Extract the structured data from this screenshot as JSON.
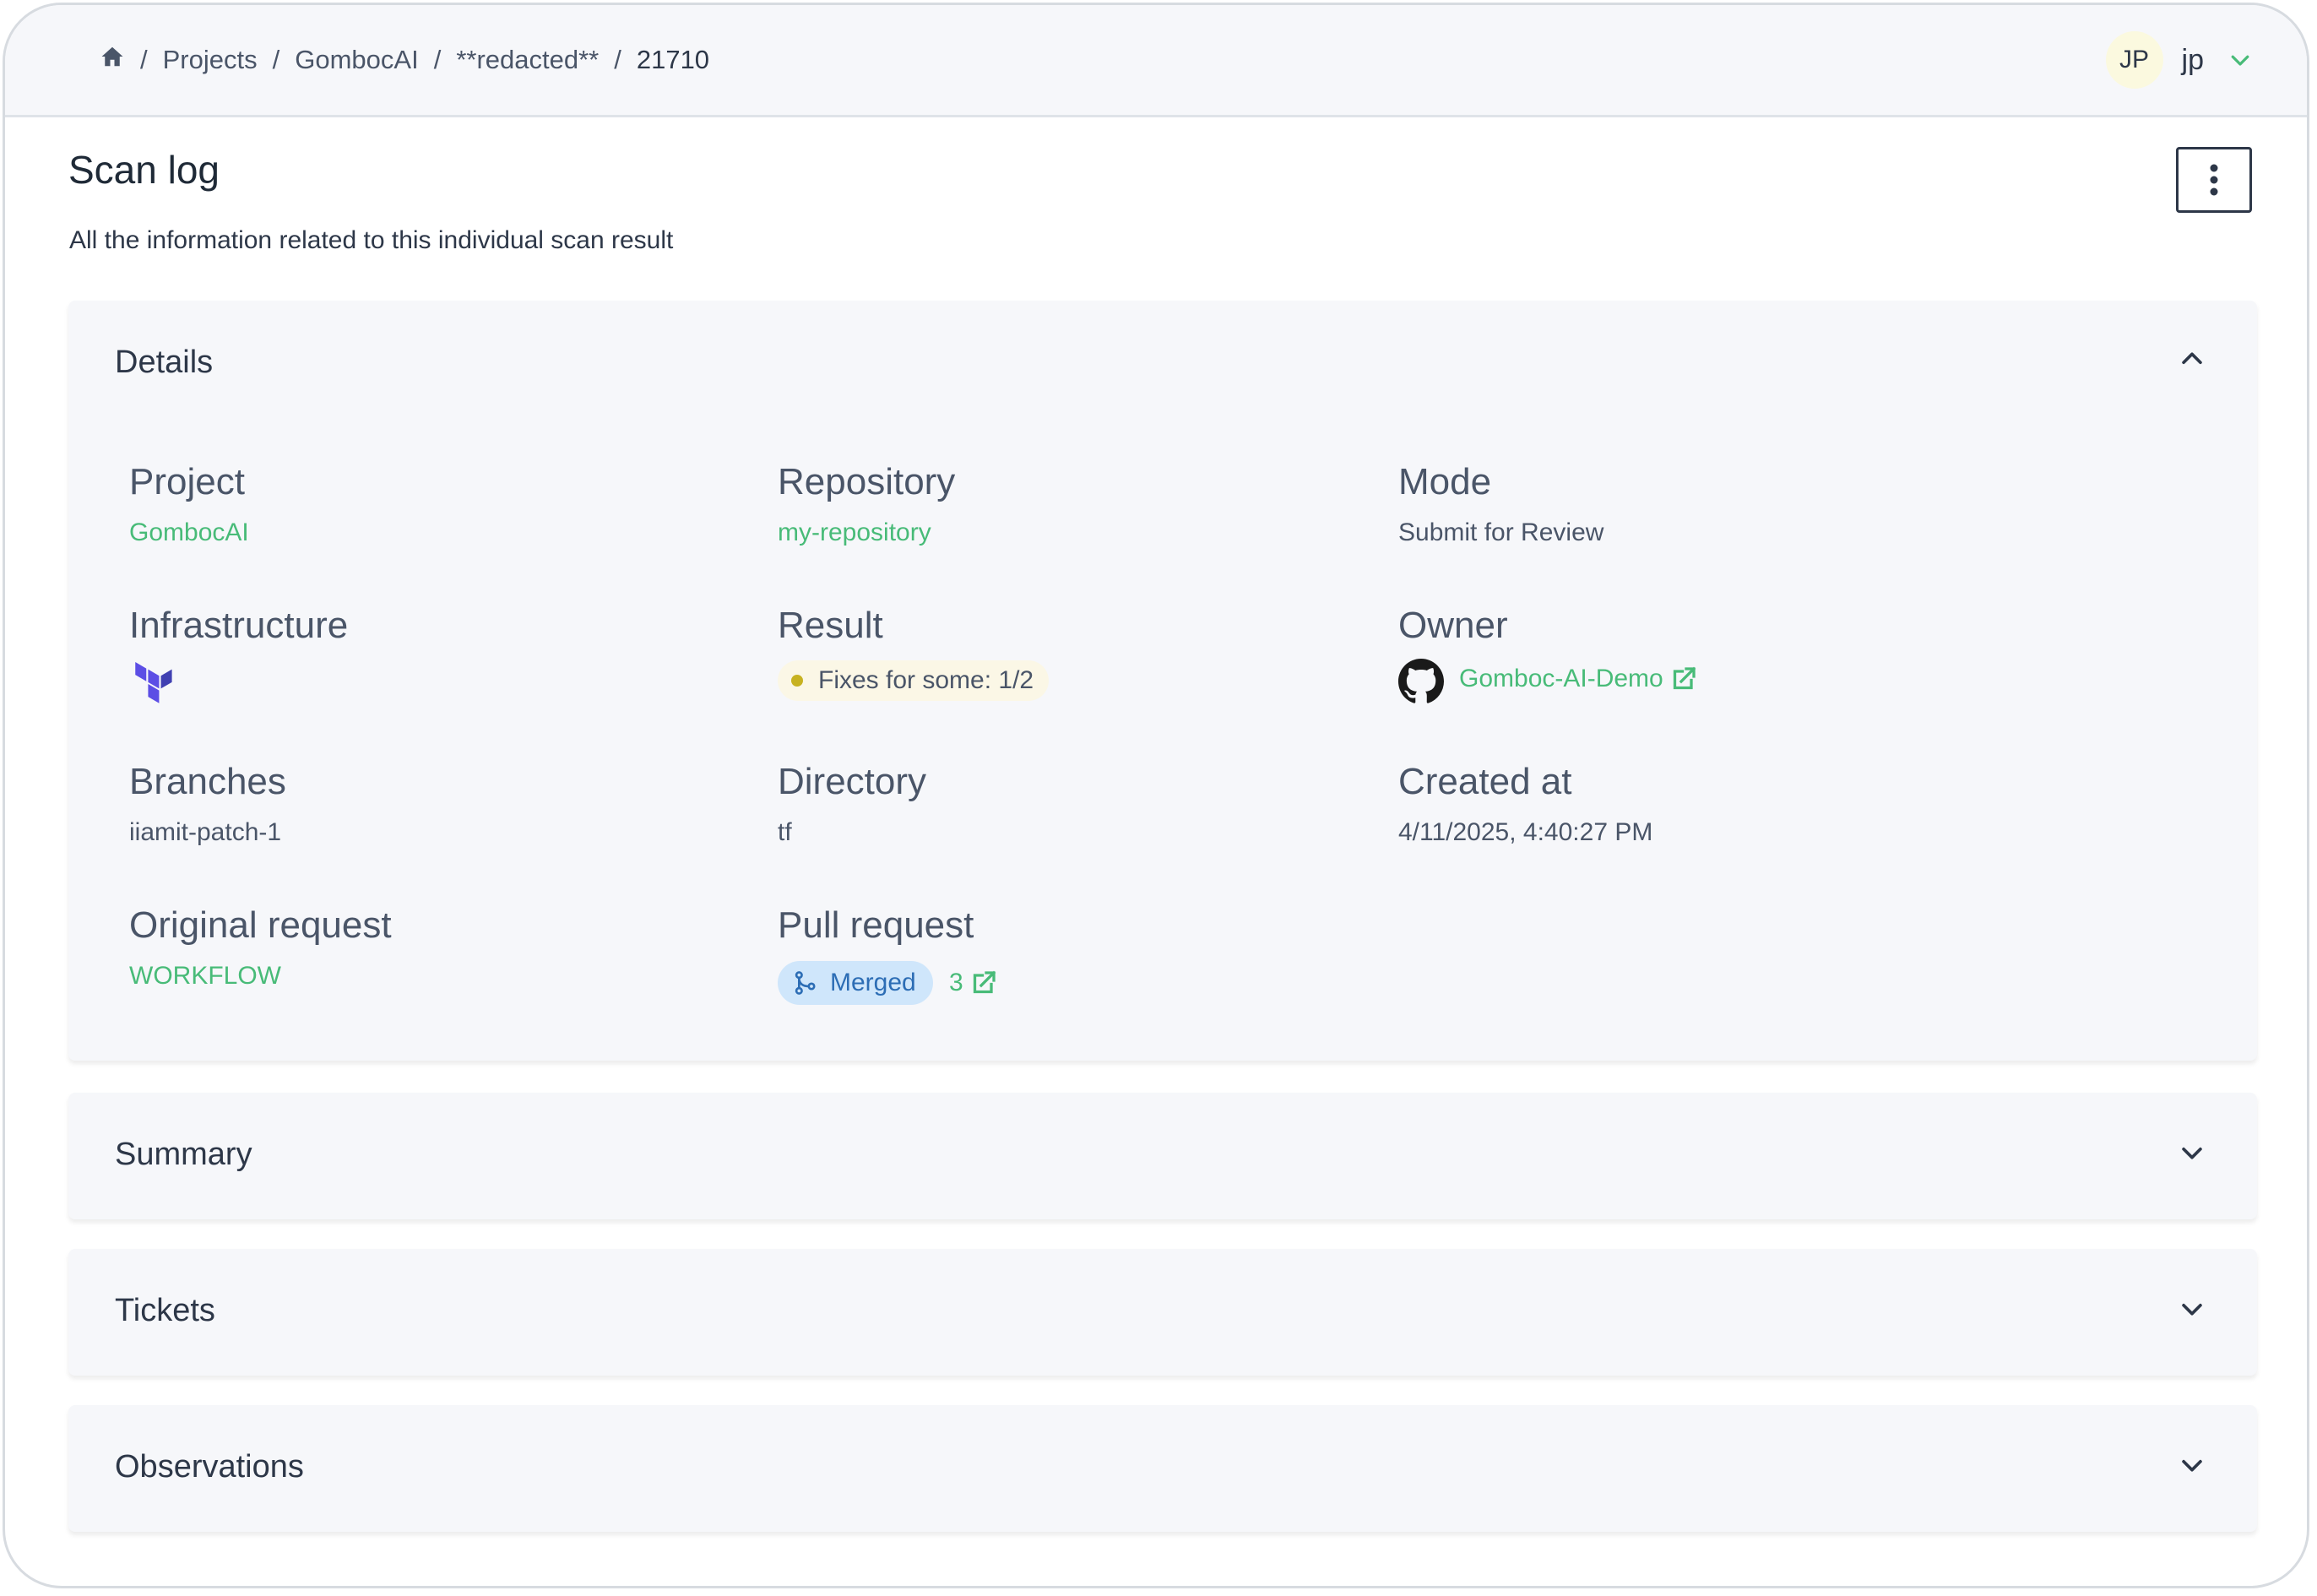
{
  "breadcrumb": {
    "items": [
      "Projects",
      "GombocAI",
      "**redacted**"
    ],
    "current": "21710",
    "separator": "/"
  },
  "user": {
    "initials": "JP",
    "name": "jp"
  },
  "page": {
    "title": "Scan log",
    "subtitle": "All the information related to this individual scan result"
  },
  "details": {
    "header": "Details",
    "project_label": "Project",
    "project_value": "GombocAI",
    "repository_label": "Repository",
    "repository_value": "my-repository",
    "mode_label": "Mode",
    "mode_value": "Submit for Review",
    "infrastructure_label": "Infrastructure",
    "infrastructure_icon": "terraform-icon",
    "result_label": "Result",
    "result_value": "Fixes for some: 1/2",
    "owner_label": "Owner",
    "owner_value": "Gomboc-AI-Demo",
    "branches_label": "Branches",
    "branches_value": "iiamit-patch-1",
    "directory_label": "Directory",
    "directory_value": "tf",
    "created_label": "Created at",
    "created_value": "4/11/2025, 4:40:27 PM",
    "original_label": "Original request",
    "original_value": "WORKFLOW",
    "pr_label": "Pull request",
    "pr_status": "Merged",
    "pr_number": "3"
  },
  "sections": {
    "summary": "Summary",
    "tickets": "Tickets",
    "observations": "Observations"
  },
  "colors": {
    "accent_green": "#48bb78",
    "merged_bg": "#cfe6fb",
    "merged_text": "#2c6db5",
    "result_dot": "#c7b221",
    "terraform": "#5c4ee5"
  }
}
